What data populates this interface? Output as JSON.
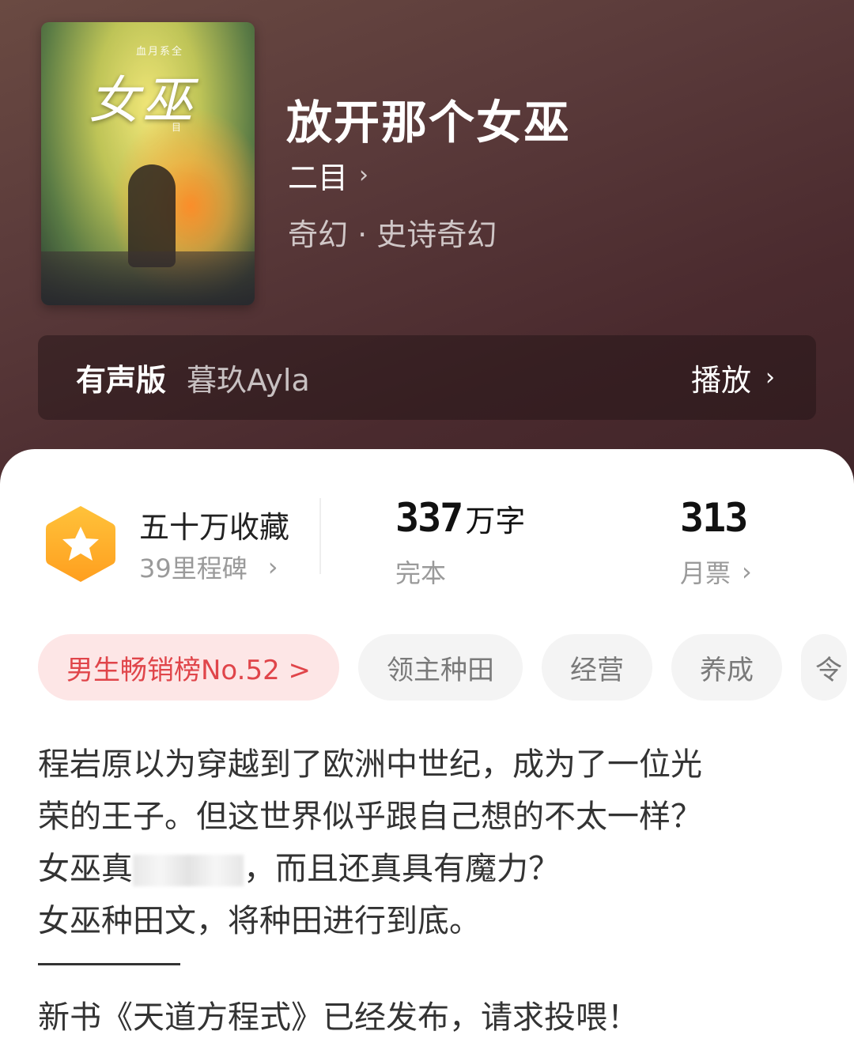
{
  "book": {
    "cover_top_text": "血月系全",
    "cover_title": "女巫",
    "cover_sub": "目",
    "title": "放开那个女巫",
    "author": "二目",
    "genre": "奇幻 · 史诗奇幻"
  },
  "audio": {
    "label": "有声版",
    "narrator": "暮玖Ayla",
    "play": "播放"
  },
  "stats": {
    "favorites": "五十万收藏",
    "milestone": "39里程碑",
    "words_num": "337",
    "words_unit": "万字",
    "status": "完本",
    "tickets_num": "313",
    "tickets_label": "月票"
  },
  "tags": {
    "rank": "男生畅销榜No.52 >",
    "items": [
      "领主种田",
      "经营",
      "养成"
    ],
    "cut_off": "令"
  },
  "description": {
    "line1": "程岩原以为穿越到了欧洲中世纪，成为了一位光",
    "line2": "荣的王子。但这世界似乎跟自己想的不太一样？",
    "line3_a": "女巫真",
    "line3_b": "，而且还真具有魔力？",
    "line4": "女巫种田文，将种田进行到底。",
    "new_book": "新书《天道方程式》已经发布，请求投喂！"
  },
  "icons": {
    "chevron": "›",
    "badge": "star-hexagon-icon"
  },
  "colors": {
    "accent_red": "#e0454a",
    "badge_orange": "#ffb12e"
  }
}
